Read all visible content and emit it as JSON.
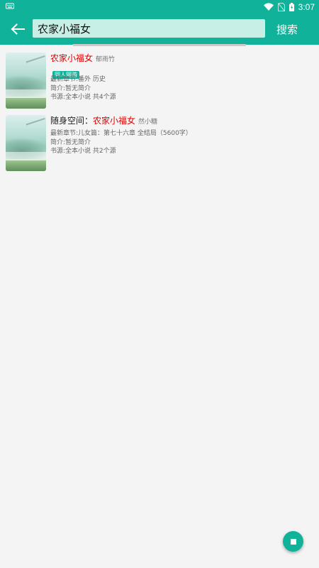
{
  "status_bar": {
    "time": "3:07",
    "icons": [
      "keyboard-icon",
      "wifi-icon",
      "no-sim-icon",
      "battery-icon"
    ],
    "background": "#10b39a"
  },
  "header": {
    "search_value": "农家小福女",
    "search_placeholder": "",
    "search_button": "搜索",
    "accent_color": "#10b39a"
  },
  "results": [
    {
      "title_prefix": "",
      "title_highlight": "农家小福女",
      "author": "郁雨竹",
      "tag": "同人网游",
      "latest": "最新章节:番外 历史",
      "intro": "简介:暂无简介",
      "source": "书源:全本小说 共4个源"
    },
    {
      "title_prefix": "随身空间：",
      "title_highlight": "农家小福女",
      "author": "然小糖",
      "tag": "",
      "latest": "最新章节:儿女篇：第七十六章 全结局（5600字）",
      "intro": "简介:暂无简介",
      "source": "书源:全本小说 共2个源"
    }
  ],
  "fab": {
    "icon": "stop-icon"
  }
}
